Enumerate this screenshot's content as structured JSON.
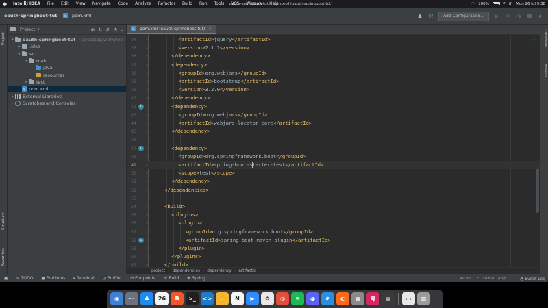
{
  "menubar": {
    "items": [
      "IntelliJ IDEA",
      "File",
      "Edit",
      "View",
      "Navigate",
      "Code",
      "Analyze",
      "Refactor",
      "Build",
      "Run",
      "Tools",
      "VCS",
      "Window",
      "Help"
    ],
    "window_title": "oauth-springboot-tut – pom.xml (oauth-springboot-tut)",
    "battery": "100%",
    "datetime": "Mon 26 Jul  9:38"
  },
  "navbar": {
    "project": "oauth-springboot-tut",
    "file": "pom.xml",
    "add_config_label": "Add Configuration..."
  },
  "project_panel": {
    "title": "Project",
    "tree": [
      {
        "label": "oauth-springboot-tut",
        "path": "~/Desktop/work/fee",
        "indent": 0,
        "arrow": "▾",
        "icon": "folder",
        "bold": true
      },
      {
        "label": ".idea",
        "indent": 1,
        "arrow": "▸",
        "icon": "folder"
      },
      {
        "label": "src",
        "indent": 1,
        "arrow": "▾",
        "icon": "folder"
      },
      {
        "label": "main",
        "indent": 2,
        "arrow": "▾",
        "icon": "folder"
      },
      {
        "label": "java",
        "indent": 3,
        "arrow": "",
        "icon": "folder-blue"
      },
      {
        "label": "resources",
        "indent": 3,
        "arrow": "",
        "icon": "folder-orange"
      },
      {
        "label": "test",
        "indent": 2,
        "arrow": "▸",
        "icon": "folder"
      },
      {
        "label": "pom.xml",
        "indent": 1,
        "arrow": "",
        "icon": "maven-file",
        "selected": true
      },
      {
        "label": "External Libraries",
        "indent": 0,
        "arrow": "▸",
        "icon": "library"
      },
      {
        "label": "Scratches and Consoles",
        "indent": 0,
        "arrow": "▸",
        "icon": "scratch"
      }
    ]
  },
  "editor": {
    "tab_label": "pom.xml (oauth-springboot-tut)",
    "current_line": 49,
    "lines": [
      {
        "n": 34,
        "indent": 4,
        "parts": [
          [
            "t",
            "<artifactId>"
          ],
          [
            "x",
            "jquery"
          ],
          [
            "t",
            "</artifactId>"
          ]
        ]
      },
      {
        "n": 35,
        "indent": 4,
        "parts": [
          [
            "t",
            "<version>"
          ],
          [
            "x",
            "2.1.1"
          ],
          [
            "t",
            "</version>"
          ]
        ]
      },
      {
        "n": 36,
        "indent": 3,
        "parts": [
          [
            "t",
            "</dependency>"
          ]
        ]
      },
      {
        "n": 37,
        "indent": 3,
        "parts": [
          [
            "t",
            "<dependency>"
          ]
        ]
      },
      {
        "n": 38,
        "indent": 4,
        "parts": [
          [
            "t",
            "<groupId>"
          ],
          [
            "x",
            "org.webjars"
          ],
          [
            "t",
            "</groupId>"
          ]
        ]
      },
      {
        "n": 39,
        "indent": 4,
        "parts": [
          [
            "t",
            "<artifactId>"
          ],
          [
            "x",
            "bootstrap"
          ],
          [
            "t",
            "</artifactId>"
          ]
        ]
      },
      {
        "n": 40,
        "indent": 4,
        "parts": [
          [
            "t",
            "<version>"
          ],
          [
            "x",
            "3.2.0"
          ],
          [
            "t",
            "</version>"
          ]
        ]
      },
      {
        "n": 41,
        "indent": 3,
        "parts": [
          [
            "t",
            "</dependency>"
          ]
        ]
      },
      {
        "n": 42,
        "indent": 3,
        "parts": [
          [
            "t",
            "<dependency>"
          ]
        ],
        "mark": true
      },
      {
        "n": 43,
        "indent": 4,
        "parts": [
          [
            "t",
            "<groupId>"
          ],
          [
            "x",
            "org.webjars"
          ],
          [
            "t",
            "</groupId>"
          ]
        ]
      },
      {
        "n": 44,
        "indent": 4,
        "parts": [
          [
            "t",
            "<artifactId>"
          ],
          [
            "x",
            "webjars-locator-core"
          ],
          [
            "t",
            "</artifactId>"
          ]
        ]
      },
      {
        "n": 45,
        "indent": 3,
        "parts": [
          [
            "t",
            "</dependency>"
          ]
        ]
      },
      {
        "n": 46,
        "indent": 0,
        "parts": []
      },
      {
        "n": 47,
        "indent": 3,
        "parts": [
          [
            "t",
            "<dependency>"
          ]
        ],
        "mark": true
      },
      {
        "n": 48,
        "indent": 4,
        "parts": [
          [
            "t",
            "<groupId>"
          ],
          [
            "x",
            "org.springframework.boot"
          ],
          [
            "t",
            "</groupId>"
          ]
        ]
      },
      {
        "n": 49,
        "indent": 4,
        "parts": [
          [
            "t",
            "<artifactId>"
          ],
          [
            "x",
            "spring-boot-s"
          ],
          [
            "c",
            ""
          ],
          [
            "x",
            "tarter-test"
          ],
          [
            "t",
            "</artifactId>"
          ]
        ]
      },
      {
        "n": 50,
        "indent": 4,
        "parts": [
          [
            "t",
            "<scope>"
          ],
          [
            "x",
            "test"
          ],
          [
            "t",
            "</scope>"
          ]
        ]
      },
      {
        "n": 51,
        "indent": 3,
        "parts": [
          [
            "t",
            "</dependency>"
          ]
        ]
      },
      {
        "n": 52,
        "indent": 2,
        "parts": [
          [
            "t",
            "</dependencies>"
          ]
        ]
      },
      {
        "n": 53,
        "indent": 0,
        "parts": []
      },
      {
        "n": 54,
        "indent": 2,
        "parts": [
          [
            "t",
            "<build>"
          ]
        ]
      },
      {
        "n": 55,
        "indent": 3,
        "parts": [
          [
            "t",
            "<plugins>"
          ]
        ]
      },
      {
        "n": 56,
        "indent": 4,
        "parts": [
          [
            "t",
            "<plugin>"
          ]
        ]
      },
      {
        "n": 57,
        "indent": 5,
        "parts": [
          [
            "t",
            "<groupId>"
          ],
          [
            "x",
            "org.springframework.boot"
          ],
          [
            "t",
            "</groupId>"
          ]
        ]
      },
      {
        "n": 58,
        "indent": 5,
        "parts": [
          [
            "t",
            "<artifactId>"
          ],
          [
            "x",
            "spring-boot-maven-plugin"
          ],
          [
            "t",
            "</artifactId>"
          ]
        ],
        "mark": true
      },
      {
        "n": 59,
        "indent": 4,
        "parts": [
          [
            "t",
            "</plugin>"
          ]
        ]
      },
      {
        "n": 60,
        "indent": 3,
        "parts": [
          [
            "t",
            "</plugins>"
          ]
        ]
      },
      {
        "n": 61,
        "indent": 2,
        "parts": [
          [
            "t",
            "</build>"
          ]
        ]
      }
    ],
    "breadcrumbs": [
      "project",
      "dependencies",
      "dependency",
      "artifactId"
    ]
  },
  "side_labels": {
    "left": [
      "Project",
      "Structure",
      "Favorites"
    ],
    "right": [
      "Database",
      "Maven"
    ]
  },
  "bottom_bar": {
    "items": [
      {
        "icon": "≡",
        "label": "TODO"
      },
      {
        "icon": "●",
        "label": "Problems"
      },
      {
        "icon": "▸",
        "label": "Terminal"
      },
      {
        "icon": "◷",
        "label": "Profiler"
      },
      {
        "icon": "✣",
        "label": "Endpoints"
      },
      {
        "icon": "⚒",
        "label": "Build"
      },
      {
        "icon": "❀",
        "label": "Spring"
      }
    ],
    "caret_pos": "49:38",
    "line_sep": "LF",
    "encoding": "UTF-8",
    "indent": "4 sp...",
    "event_log": "Event Log"
  },
  "dock": {
    "apps": [
      {
        "name": "Finder",
        "short": "◉",
        "color": "#3b82d8"
      },
      {
        "name": "Launchpad",
        "short": "⋯",
        "color": "#6b7280"
      },
      {
        "name": "App Store",
        "short": "A",
        "color": "#1c8df0"
      },
      {
        "name": "Calendar",
        "short": "26",
        "color": "#f5f5f5"
      },
      {
        "name": "Brave",
        "short": "B",
        "color": "#f0572a"
      },
      {
        "name": "Terminal",
        "short": ">_",
        "color": "#1f1f1f"
      },
      {
        "name": "VS Code",
        "short": "<>",
        "color": "#1f7acc"
      },
      {
        "name": "Hand",
        "short": "✋",
        "color": "#f2b632"
      },
      {
        "name": "Notion",
        "short": "N",
        "color": "#f5f5f5"
      },
      {
        "name": "Zoom",
        "short": "▶",
        "color": "#2d8cff"
      },
      {
        "name": "Photos",
        "short": "✿",
        "color": "#e8e8e8"
      },
      {
        "name": "Chrome",
        "short": "◎",
        "color": "#e44d3a"
      },
      {
        "name": "Spotify",
        "short": "≋",
        "color": "#1db954"
      },
      {
        "name": "Discord",
        "short": "◕",
        "color": "#5865f2"
      },
      {
        "name": "Safari",
        "short": "⊕",
        "color": "#2a8fe0"
      },
      {
        "name": "Firefox",
        "short": "◐",
        "color": "#ff6a1a"
      },
      {
        "name": "Preview",
        "short": "▦",
        "color": "#8a8a8a"
      },
      {
        "name": "IntelliJ IDEA",
        "short": "IJ",
        "color": "#d6285f"
      },
      {
        "name": "Activity Monitor",
        "short": "▤",
        "color": "#3a3a3a"
      },
      {
        "name": "Documents",
        "short": "▭",
        "color": "#e8e8e8"
      },
      {
        "name": "Trash",
        "short": "▥",
        "color": "#9b9b9b"
      }
    ]
  },
  "colors": {
    "tag": "#e8bf6a",
    "text": "#a9b7c6",
    "accent": "#4a88c7",
    "run_green": "#499c54"
  }
}
